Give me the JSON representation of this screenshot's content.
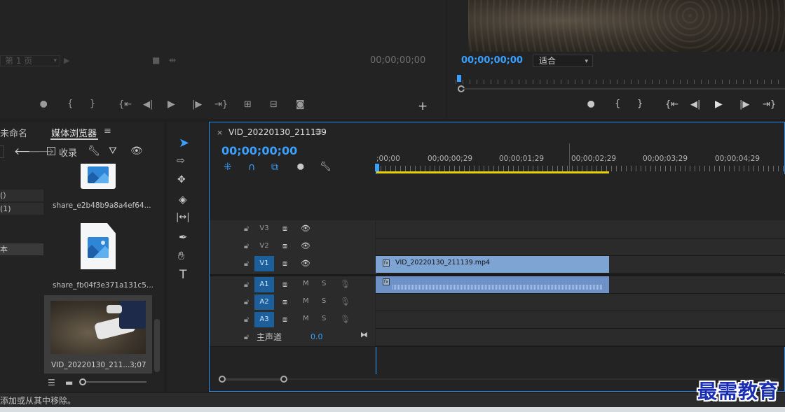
{
  "source_monitor": {
    "page_select": "第 1 页",
    "timecode": "00;00;00;00"
  },
  "program_monitor": {
    "timecode": "00;00;00;00",
    "fit_select": "适合"
  },
  "project_panel": {
    "tab_partial": "未命名",
    "tab_media_browser": "媒体浏览器",
    "favorites_label": "收录",
    "left_items": [
      "(）",
      "(1)",
      "本"
    ],
    "files": [
      {
        "name": "share_e2b48b9a8a4ef64...",
        "kind": "image"
      },
      {
        "name": "share_fb04f3e371a131c5...",
        "kind": "image"
      },
      {
        "name": "VID_20220130_211...",
        "duration": "3;07",
        "kind": "video"
      }
    ]
  },
  "timeline": {
    "sequence_name": "VID_20220130_211139",
    "timecode": "00;00;00;00",
    "ruler_labels": [
      ";00;00",
      "00;00;00;29",
      "00;00;01;29",
      "00;00;02;29",
      "00;00;03;29",
      "00;00;04;29"
    ],
    "video_tracks": [
      "V3",
      "V2",
      "V1"
    ],
    "audio_tracks": [
      "A1",
      "A2",
      "A3"
    ],
    "master_label": "主声道",
    "master_value": "0.0",
    "mute_label": "M",
    "solo_label": "S",
    "clip_name": "VID_20220130_211139.mp4"
  },
  "status_bar": {
    "text": "添加或从其中移除。"
  },
  "watermark": {
    "text": "最需教育"
  },
  "colors": {
    "accent": "#2d8ceb",
    "timecode": "#3aa0ff",
    "clip_video": "#7ea4d4",
    "clip_audio": "#6e92c8",
    "work_area": "#e8d000"
  }
}
